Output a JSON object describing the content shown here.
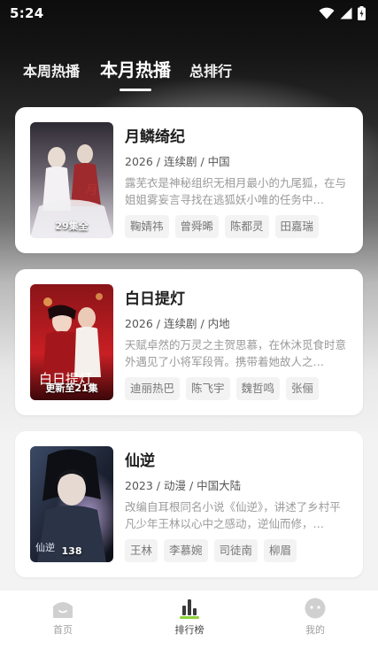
{
  "status_bar": {
    "time": "5:24",
    "icons": [
      "wifi-icon",
      "cell-signal-icon",
      "battery-charging-icon"
    ]
  },
  "tabs": [
    {
      "label": "本周热播",
      "active": false
    },
    {
      "label": "本月热播",
      "active": true
    },
    {
      "label": "总排行",
      "active": false
    }
  ],
  "items": [
    {
      "title": "月鳞绮纪",
      "meta": "2026 / 连续剧 / 中国",
      "description": "露芜衣是神秘组织无相月最小的九尾狐，在与姐姐雾妄言寻找在逃狐妖小唯的任务中…",
      "badge": "29集全",
      "cast": [
        "鞠婧祎",
        "曾舜晞",
        "陈都灵",
        "田嘉瑞"
      ],
      "poster_colors": [
        "#e9e6ee",
        "#4b3f4f",
        "#9e2a2e"
      ]
    },
    {
      "title": "白日提灯",
      "meta": "2026 / 连续剧 / 内地",
      "description": "天赋卓然的万灵之主贺思慕，在休沐觅食时意外遇见了小将军段胥。携带着她故人之…",
      "badge": "更新至21集",
      "cast": [
        "迪丽热巴",
        "陈飞宇",
        "魏哲鸣",
        "张俪"
      ],
      "poster_colors": [
        "#c81f24",
        "#5a0d10",
        "#f0b25b"
      ]
    },
    {
      "title": "仙逆",
      "meta": "2023 / 动漫 / 中国大陆",
      "description": "改编自耳根同名小说《仙逆》，讲述了乡村平凡少年王林以心中之感动，逆仙而修，…",
      "badge": "138",
      "cast": [
        "王林",
        "李慕婉",
        "司徒南",
        "柳眉"
      ],
      "poster_colors": [
        "#2a3140",
        "#6c7fa8",
        "#b9a4d8"
      ]
    }
  ],
  "bottom_nav": [
    {
      "label": "首页",
      "icon": "home-icon",
      "active": false
    },
    {
      "label": "排行榜",
      "icon": "ranking-chart-icon",
      "active": true
    },
    {
      "label": "我的",
      "icon": "profile-face-icon",
      "active": false
    }
  ],
  "accent_color": "#8dd13f"
}
